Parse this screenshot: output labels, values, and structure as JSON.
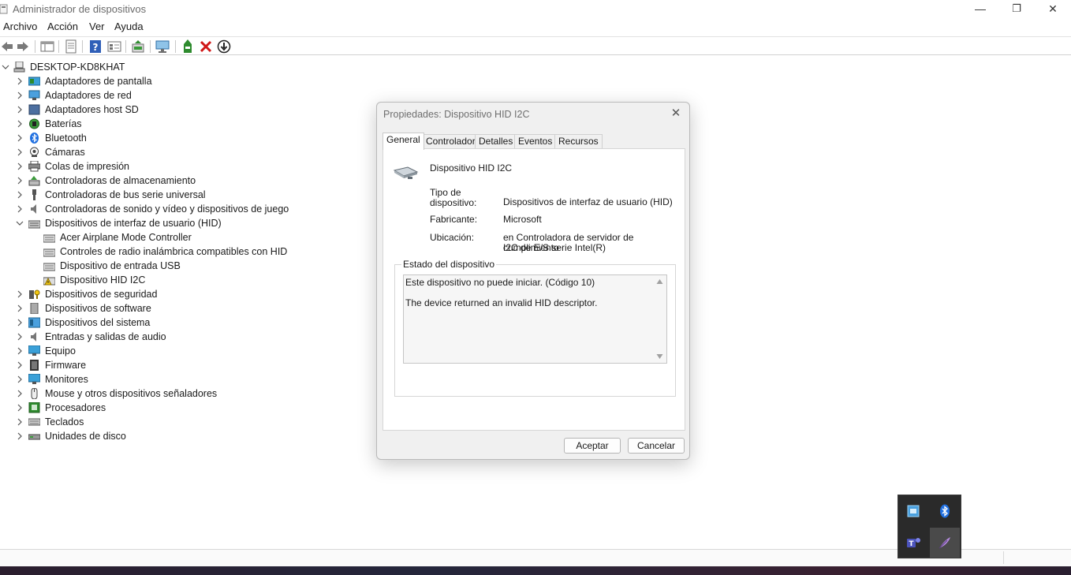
{
  "window": {
    "title": "Administrador de dispositivos",
    "minimize": "—",
    "maximize": "❐",
    "close": "✕"
  },
  "menu": [
    "Archivo",
    "Acción",
    "Ver",
    "Ayuda"
  ],
  "tree": {
    "root": "DESKTOP-KD8KHAT",
    "items": [
      {
        "label": "Adaptadores de pantalla",
        "icon": "display-adapter-icon"
      },
      {
        "label": "Adaptadores de red",
        "icon": "network-adapter-icon"
      },
      {
        "label": "Adaptadores host SD",
        "icon": "sd-host-icon"
      },
      {
        "label": "Baterías",
        "icon": "battery-icon"
      },
      {
        "label": "Bluetooth",
        "icon": "bluetooth-icon"
      },
      {
        "label": "Cámaras",
        "icon": "camera-icon"
      },
      {
        "label": "Colas de impresión",
        "icon": "printer-icon"
      },
      {
        "label": "Controladoras de almacenamiento",
        "icon": "storage-controller-icon"
      },
      {
        "label": "Controladoras de bus serie universal",
        "icon": "usb-icon"
      },
      {
        "label": "Controladoras de sonido y vídeo y dispositivos de juego",
        "icon": "sound-icon"
      },
      {
        "label": "Dispositivos de interfaz de usuario (HID)",
        "icon": "hid-icon",
        "expanded": true,
        "children": [
          {
            "label": "Acer Airplane Mode Controller",
            "icon": "hid-device-icon"
          },
          {
            "label": "Controles de radio inalámbrica compatibles con HID",
            "icon": "hid-device-icon"
          },
          {
            "label": "Dispositivo de entrada USB",
            "icon": "hid-device-icon"
          },
          {
            "label": "Dispositivo HID I2C",
            "icon": "hid-warning-icon"
          }
        ]
      },
      {
        "label": "Dispositivos de seguridad",
        "icon": "security-icon"
      },
      {
        "label": "Dispositivos de software",
        "icon": "software-device-icon"
      },
      {
        "label": "Dispositivos del sistema",
        "icon": "system-device-icon"
      },
      {
        "label": "Entradas y salidas de audio",
        "icon": "audio-io-icon"
      },
      {
        "label": "Equipo",
        "icon": "computer-icon"
      },
      {
        "label": "Firmware",
        "icon": "firmware-icon"
      },
      {
        "label": "Monitores",
        "icon": "monitor-icon"
      },
      {
        "label": "Mouse y otros dispositivos señaladores",
        "icon": "mouse-icon"
      },
      {
        "label": "Procesadores",
        "icon": "processor-icon"
      },
      {
        "label": "Teclados",
        "icon": "keyboard-icon"
      },
      {
        "label": "Unidades de disco",
        "icon": "disk-drive-icon"
      }
    ]
  },
  "dialog": {
    "title": "Propiedades: Dispositivo HID I2C",
    "tabs": [
      "General",
      "Controlador",
      "Detalles",
      "Eventos",
      "Recursos"
    ],
    "device_name": "Dispositivo HID I2C",
    "type_label_1": "Tipo de",
    "type_label_2": "dispositivo:",
    "type_value": "Dispositivos de interfaz de usuario (HID)",
    "manufacturer_label": "Fabricante:",
    "manufacturer_value": "Microsoft",
    "location_label": "Ubicación:",
    "location_value_1": "en Controladora de servidor de cumplimiento",
    "location_value_2": "I2C de E/S serie Intel(R)",
    "status_group": "Estado del dispositivo",
    "status_line_1": "Este dispositivo no puede iniciar. (Código 10)",
    "status_line_2": "The device returned an invalid HID descriptor.",
    "ok": "Aceptar",
    "cancel": "Cancelar"
  },
  "colors": {
    "accent": "#1a73c8",
    "delete_red": "#d01818",
    "warning_yellow": "#f2c811"
  }
}
